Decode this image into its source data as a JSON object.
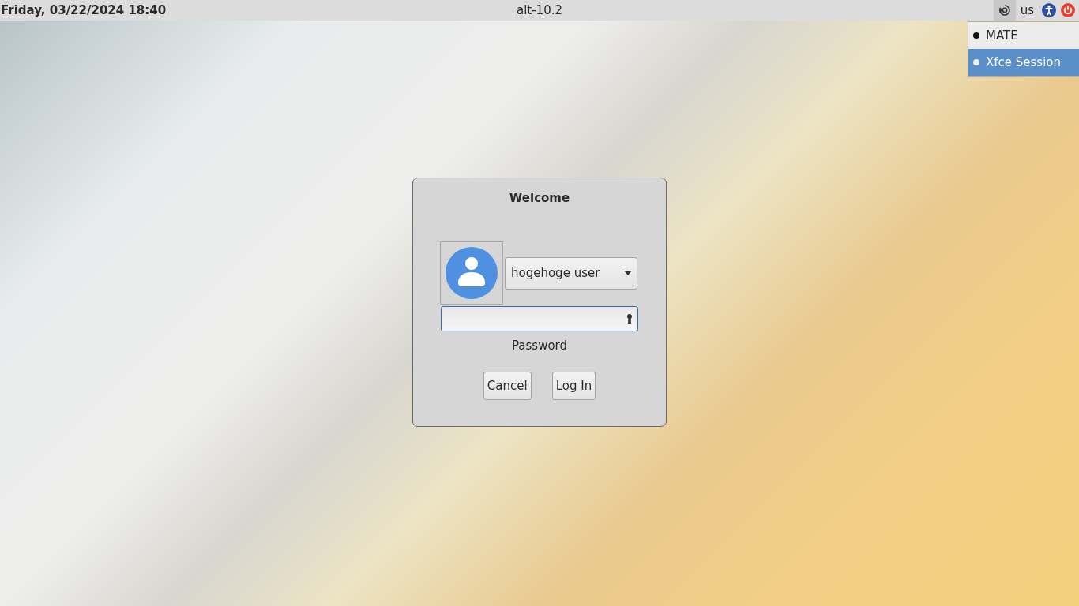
{
  "top_bar": {
    "clock": "Friday, 03/22/2024 18:40",
    "hostname": "alt-10.2",
    "keyboard_layout": "us",
    "session_menu_open": true
  },
  "session_menu": [
    {
      "label": "MATE",
      "selected": true,
      "highlighted": false
    },
    {
      "label": "Xfce Session",
      "selected": false,
      "highlighted": true
    }
  ],
  "login_dialog": {
    "title": "Welcome",
    "user": "hogehoge user",
    "password_label": "Password",
    "buttons": [
      "Cancel",
      "Log In"
    ]
  }
}
